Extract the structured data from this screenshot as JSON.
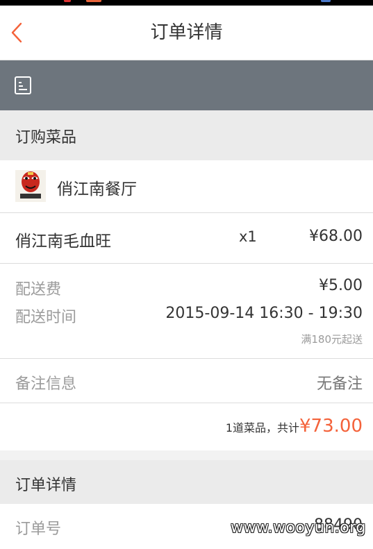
{
  "nav": {
    "title": "订单详情",
    "back_icon": "chevron-left-icon"
  },
  "banner": {
    "icon": "receipt-icon"
  },
  "order_section": {
    "header": "订购菜品"
  },
  "restaurant": {
    "name": "俏江南餐厅"
  },
  "dish": {
    "name": "俏江南毛血旺",
    "qty": "x1",
    "price": "¥68.00"
  },
  "delivery": {
    "fee_label": "配送费",
    "fee_value": "¥5.00",
    "time_label": "配送时间",
    "time_value": "2015-09-14 16:30 - 19:30",
    "min_order_note": "满180元起送"
  },
  "remark": {
    "label": "备注信息",
    "value": "无备注"
  },
  "summary": {
    "text": "1道菜品，共计",
    "total": "¥73.00"
  },
  "details_section": {
    "header": "订单详情",
    "order_no_label": "订单号",
    "order_no_value": "88490"
  },
  "watermark": "www.wooyun.org",
  "colors": {
    "accent": "#f4623a",
    "banner": "#6d757d",
    "section_bg": "#ebebeb"
  }
}
